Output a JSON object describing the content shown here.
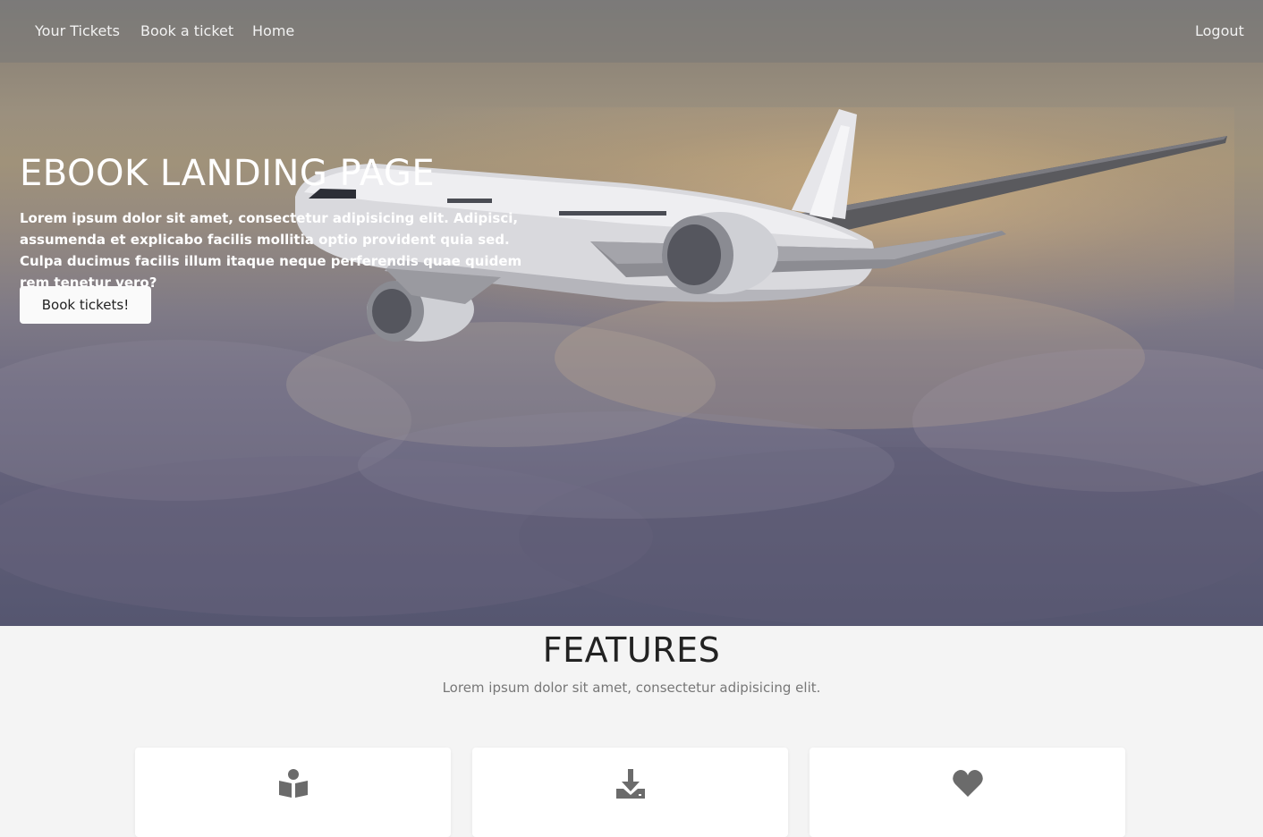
{
  "navbar": {
    "links": [
      {
        "label": "Your Tickets"
      },
      {
        "label": "Book a ticket"
      },
      {
        "label": "Home"
      }
    ],
    "logout_label": "Logout"
  },
  "hero": {
    "title": "EBOOK LANDING PAGE",
    "text": "Lorem ipsum dolor sit amet, consectetur adipisicing elit. Adipisci, assumenda et explicabo facilis mollitia optio provident quia sed. Culpa ducimus facilis illum itaque neque perferendis quae quidem rem tenetur vero?",
    "button_label": "Book tickets!"
  },
  "features": {
    "title": "FEATURES",
    "subtitle": "Lorem ipsum dolor sit amet, consectetur adipisicing elit.",
    "cards": [
      {
        "icon": "book-reader-icon"
      },
      {
        "icon": "download-icon"
      },
      {
        "icon": "heart-icon"
      }
    ]
  },
  "colors": {
    "icon": "#6b6b6b",
    "nav_text": "#f2f2f2",
    "hero_text": "#ffffff"
  }
}
